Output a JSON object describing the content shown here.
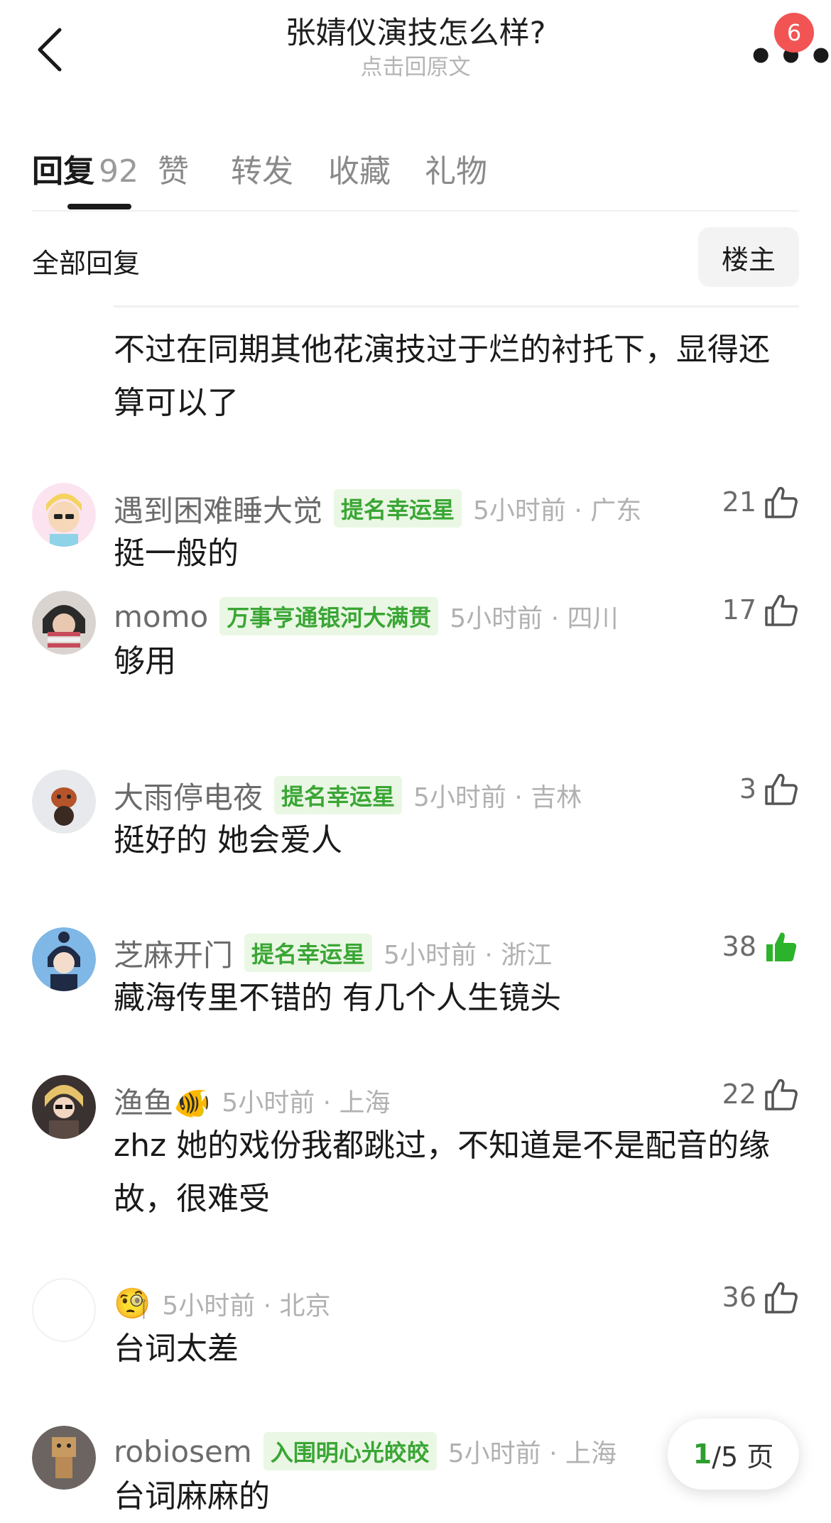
{
  "header": {
    "title": "张婧仪演技怎么样?",
    "subtitle": "点击回原文",
    "badge_count": "6"
  },
  "tabs": [
    {
      "label": "回复",
      "count": "92",
      "active": true
    },
    {
      "label": "赞"
    },
    {
      "label": "转发"
    },
    {
      "label": "收藏"
    },
    {
      "label": "礼物"
    }
  ],
  "filter": {
    "label": "全部回复",
    "owner_button": "楼主"
  },
  "previous_comment_tail": "不过在同期其他花演技过于烂的衬托下，显得还算可以了",
  "comments": [
    {
      "username": "遇到困难睡大觉",
      "tag": "提名幸运星",
      "time": "5小时前 · 广东",
      "text": "挺一般的",
      "likes": "21",
      "liked": false
    },
    {
      "username": "momo",
      "tag": "万事亨通银河大满贯",
      "time": "5小时前 · 四川",
      "text": "够用",
      "likes": "17",
      "liked": false
    },
    {
      "username": "大雨停电夜",
      "tag": "提名幸运星",
      "time": "5小时前 · 吉林",
      "text": "挺好的 她会爱人",
      "likes": "3",
      "liked": false
    },
    {
      "username": "芝麻开门",
      "tag": "提名幸运星",
      "time": "5小时前 · 浙江",
      "text": "藏海传里不错的 有几个人生镜头",
      "likes": "38",
      "liked": true
    },
    {
      "username": "渔鱼🐠",
      "tag": "",
      "time": "5小时前 · 上海",
      "text": "zhz 她的戏份我都跳过，不知道是不是配音的缘故，很难受",
      "likes": "22",
      "liked": false
    },
    {
      "username": "🧐",
      "tag": "",
      "time": "5小时前 · 北京",
      "text": "台词太差",
      "likes": "36",
      "liked": false
    },
    {
      "username": "robiosem",
      "tag": "入围明心光皎皎",
      "time": "5小时前 · 上海",
      "text": "台词麻麻的",
      "likes": "",
      "liked": false
    }
  ],
  "pager": {
    "current": "1",
    "total": "/5 页"
  },
  "colors": {
    "tag_bg": "#eaf7e4",
    "tag_text": "#3aa635",
    "liked": "#2bb32b",
    "badge": "#f25353"
  }
}
